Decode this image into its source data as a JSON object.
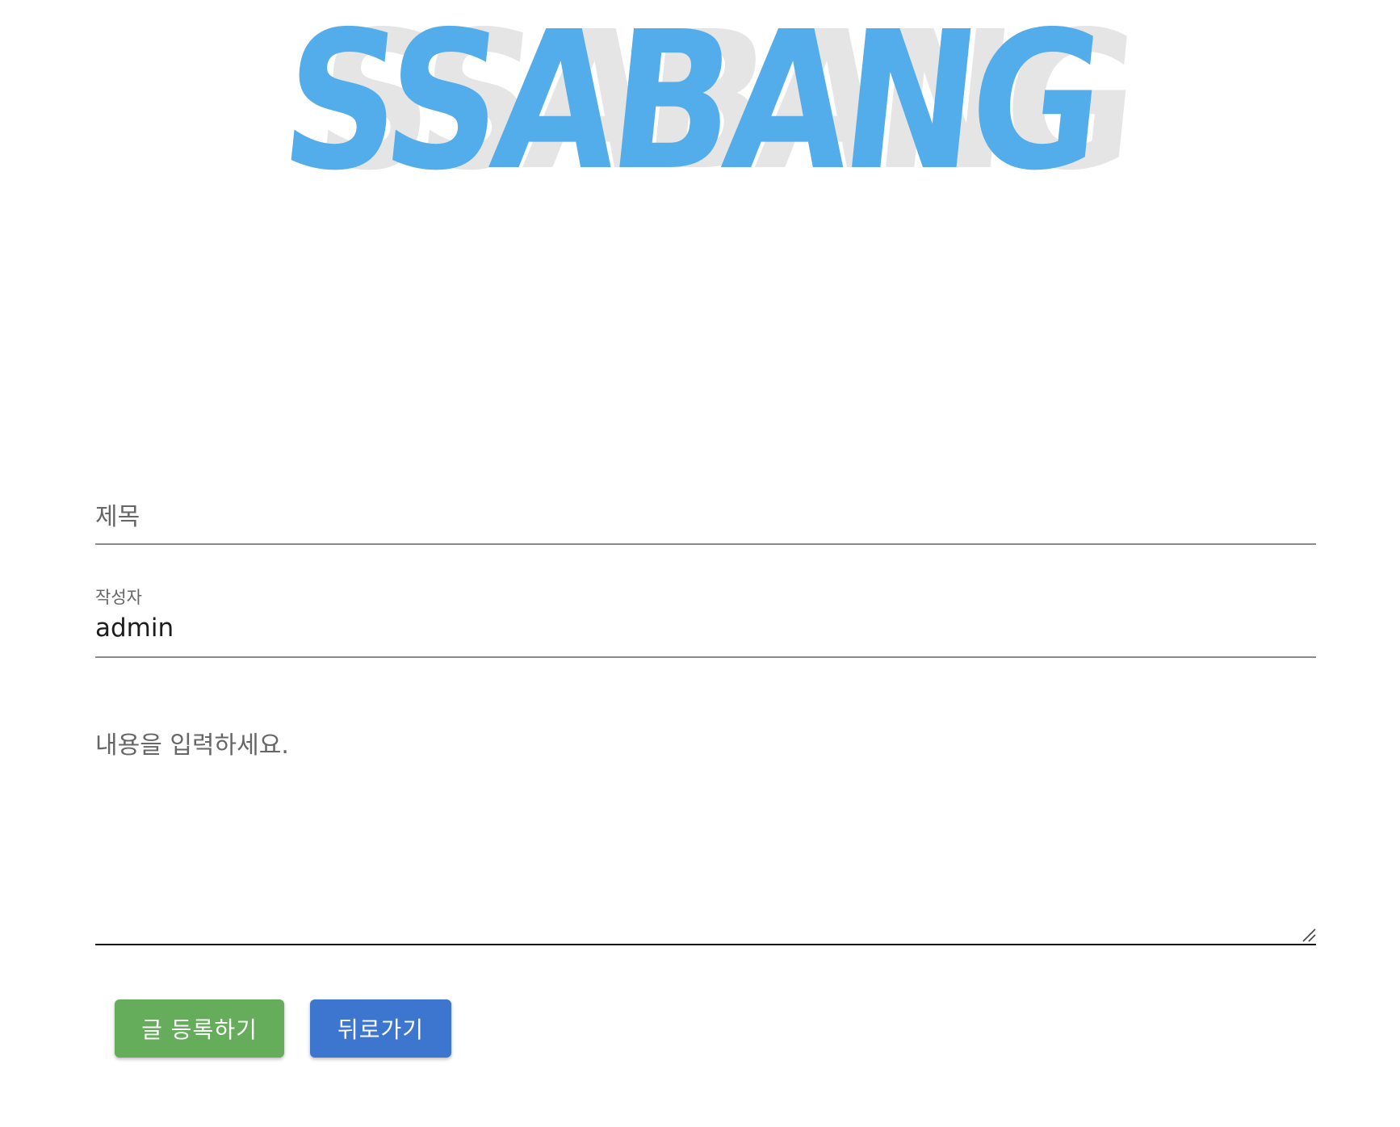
{
  "logo": {
    "text": "SSABANG",
    "color": "#52adea",
    "shadow_color": "#e5e5e5"
  },
  "form": {
    "title_placeholder": "제목",
    "author_label": "작성자",
    "author_value": "admin",
    "content_placeholder": "내용을 입력하세요."
  },
  "buttons": {
    "submit_label": "글 등록하기",
    "submit_color": "#65ad5b",
    "back_label": "뒤로가기",
    "back_color": "#3c76cf"
  },
  "icons": {
    "textarea_resize": "resize-handle-icon"
  }
}
